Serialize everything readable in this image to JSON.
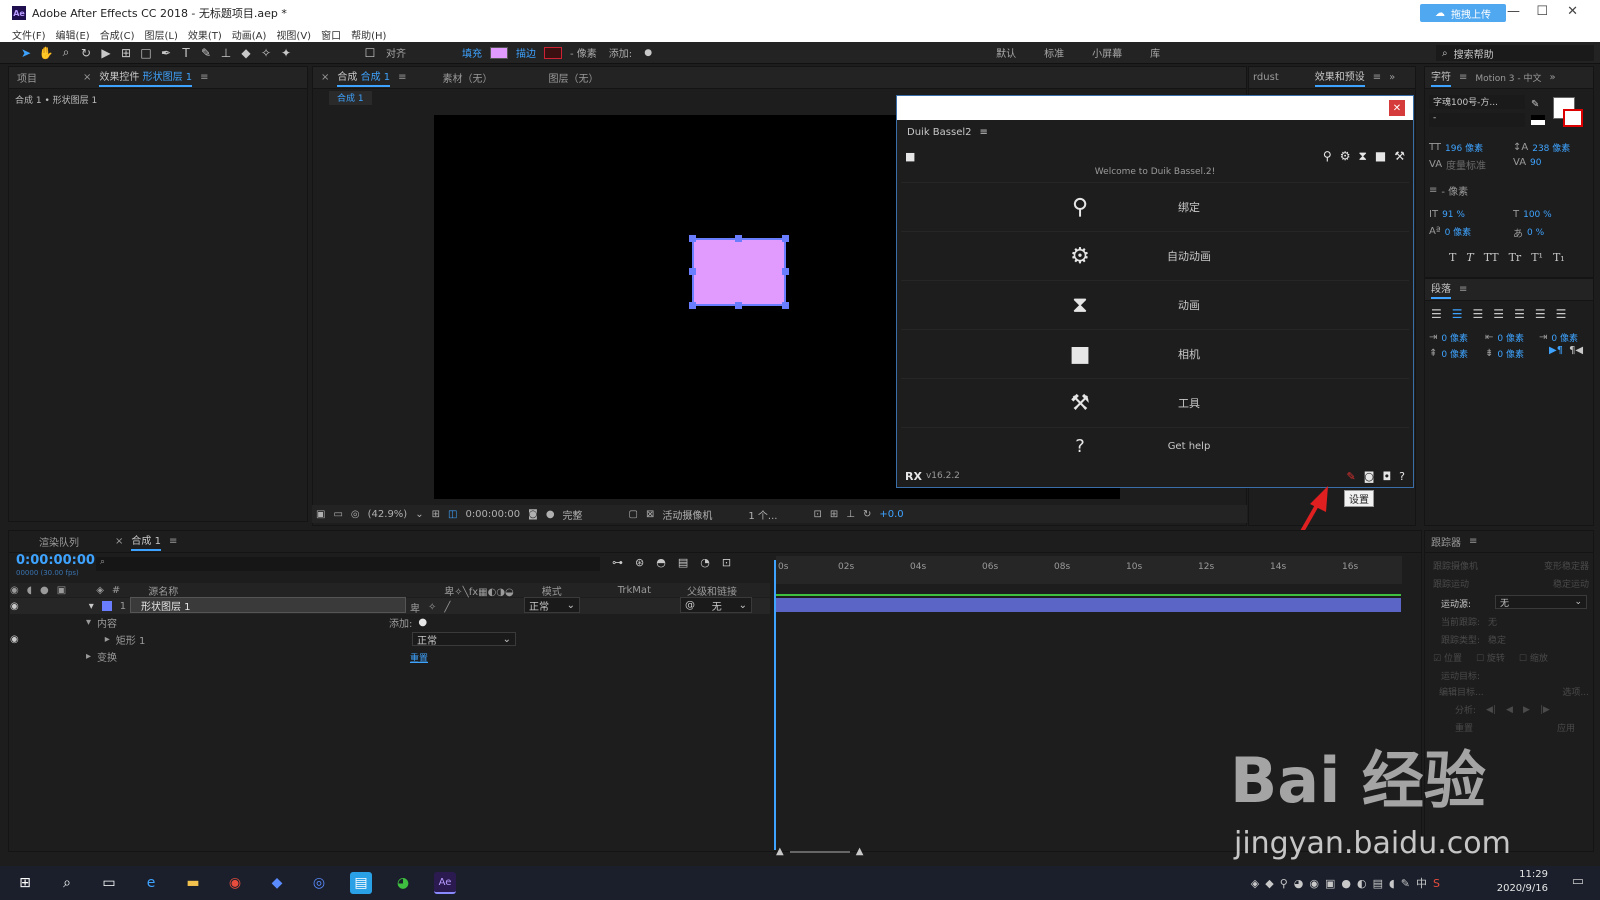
{
  "window": {
    "title": "Adobe After Effects CC 2018 - 无标题项目.aep *",
    "app_badge": "Ae",
    "upload_button": "拖拽上传"
  },
  "menu": [
    "文件(F)",
    "编辑(E)",
    "合成(C)",
    "图层(L)",
    "效果(T)",
    "动画(A)",
    "视图(V)",
    "窗口",
    "帮助(H)"
  ],
  "toolbar": {
    "snap_label": "对齐",
    "fill_label": "填充",
    "stroke_label": "描边",
    "stroke_px": "- 像素",
    "add_label": "添加:",
    "workspaces": [
      "默认",
      "标准",
      "小屏幕",
      "库"
    ],
    "search_help": "搜索帮助",
    "fill_color": "#e19bff"
  },
  "project_panel": {
    "tab_project": "项目",
    "tab_effects": "效果控件",
    "effects_target": "形状图层 1",
    "breadcrumb": "合成 1 • 形状图层 1"
  },
  "comp_panel": {
    "tab_comp": "合成",
    "comp_name": "合成 1",
    "tab_footage": "素材（无）",
    "tab_layer": "图层（无）",
    "sub_tab": "合成 1",
    "zoom": "(42.9%)",
    "time": "0:00:00:00",
    "quality": "完整",
    "camera": "活动摄像机",
    "views": "1 个...",
    "exposure": "+0.0"
  },
  "side_tabs": {
    "rdust": "rdust",
    "effects_presets": "效果和预设"
  },
  "duik": {
    "title": "Duik Bassel2",
    "welcome": "Welcome to Duik Bassel.2!",
    "items": [
      {
        "icon": "bone",
        "label": "绑定"
      },
      {
        "icon": "gear",
        "label": "自动动画"
      },
      {
        "icon": "hourglass",
        "label": "动画"
      },
      {
        "icon": "camera",
        "label": "相机"
      },
      {
        "icon": "tools",
        "label": "工具"
      },
      {
        "icon": "help",
        "label": "Get help"
      }
    ],
    "logo": "RX",
    "version": "v16.2.2",
    "tooltip": "设置"
  },
  "timeline": {
    "tab_render": "渲染队列",
    "tab_comp": "合成 1",
    "timecode": "0:00:00:00",
    "fps": "00000 (30.00 fps)",
    "columns": {
      "source_name": "源名称",
      "mode": "模式",
      "trkmat": "TrkMat",
      "parent": "父级和链接"
    },
    "layer": {
      "index": "1",
      "name": "形状图层 1",
      "mode": "正常",
      "parent": "无"
    },
    "contents_label": "内容",
    "add_label": "添加:",
    "rect_label": "矩形 1",
    "rect_mode": "正常",
    "transform_label": "变换",
    "reset_label": "重置",
    "ruler_ticks": [
      "0s",
      "02s",
      "04s",
      "06s",
      "08s",
      "10s",
      "12s",
      "14s",
      "16s"
    ]
  },
  "character_panel": {
    "tab_char": "字符",
    "tab_motion": "Motion 3 - 中文",
    "font": "字魂100号-方...",
    "font_style": "-",
    "size": "196 像素",
    "leading": "238 像素",
    "kerning": "度量标准",
    "tracking": "90",
    "stroke_width": "- 像素",
    "vscale": "91 %",
    "hscale": "100 %",
    "baseline": "0 像素",
    "tsume": "0 %",
    "style_buttons": [
      "T",
      "T",
      "TT",
      "Tr",
      "T¹",
      "T₁"
    ]
  },
  "paragraph_panel": {
    "tab": "段落",
    "indent_values": [
      "0 像素",
      "0 像素",
      "0 像素",
      "0 像素",
      "0 像素"
    ]
  },
  "tracker_panel": {
    "tab": "跟踪器",
    "track_camera": "跟踪摄像机",
    "warp_stabilizer": "变形稳定器",
    "track_motion": "跟踪运动",
    "stabilize_motion": "稳定运动",
    "motion_source_label": "运动源:",
    "motion_source_value": "无",
    "current_track_label": "当前跟踪:",
    "current_track_value": "无",
    "track_type_label": "跟踪类型:",
    "track_type_value": "稳定",
    "checks": [
      "位置",
      "旋转",
      "缩放"
    ],
    "motion_target": "运动目标:",
    "edit_target": "编辑目标...",
    "options": "选项...",
    "analyze": "分析:",
    "reset": "重置",
    "apply": "应用"
  },
  "taskbar": {
    "ime": "中",
    "time": "11:29",
    "date": "2020/9/16"
  },
  "watermark": {
    "brand": "Bai 经验",
    "url": "jingyan.baidu.com"
  }
}
